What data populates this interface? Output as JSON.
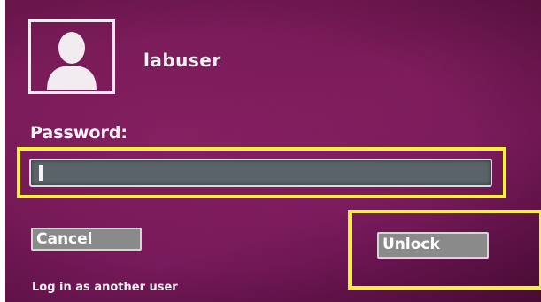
{
  "user": {
    "name": "labuser",
    "avatar_icon": "user-silhouette-icon"
  },
  "password": {
    "label": "Password:",
    "value": ""
  },
  "buttons": {
    "cancel_label": "Cancel",
    "unlock_label": "Unlock"
  },
  "links": {
    "another_user": "Log in as another user"
  },
  "colors": {
    "background": "#6e1550",
    "highlight": "#f5f03a",
    "field_fill": "#5a6468",
    "button_fill": "#8a8a8a"
  }
}
